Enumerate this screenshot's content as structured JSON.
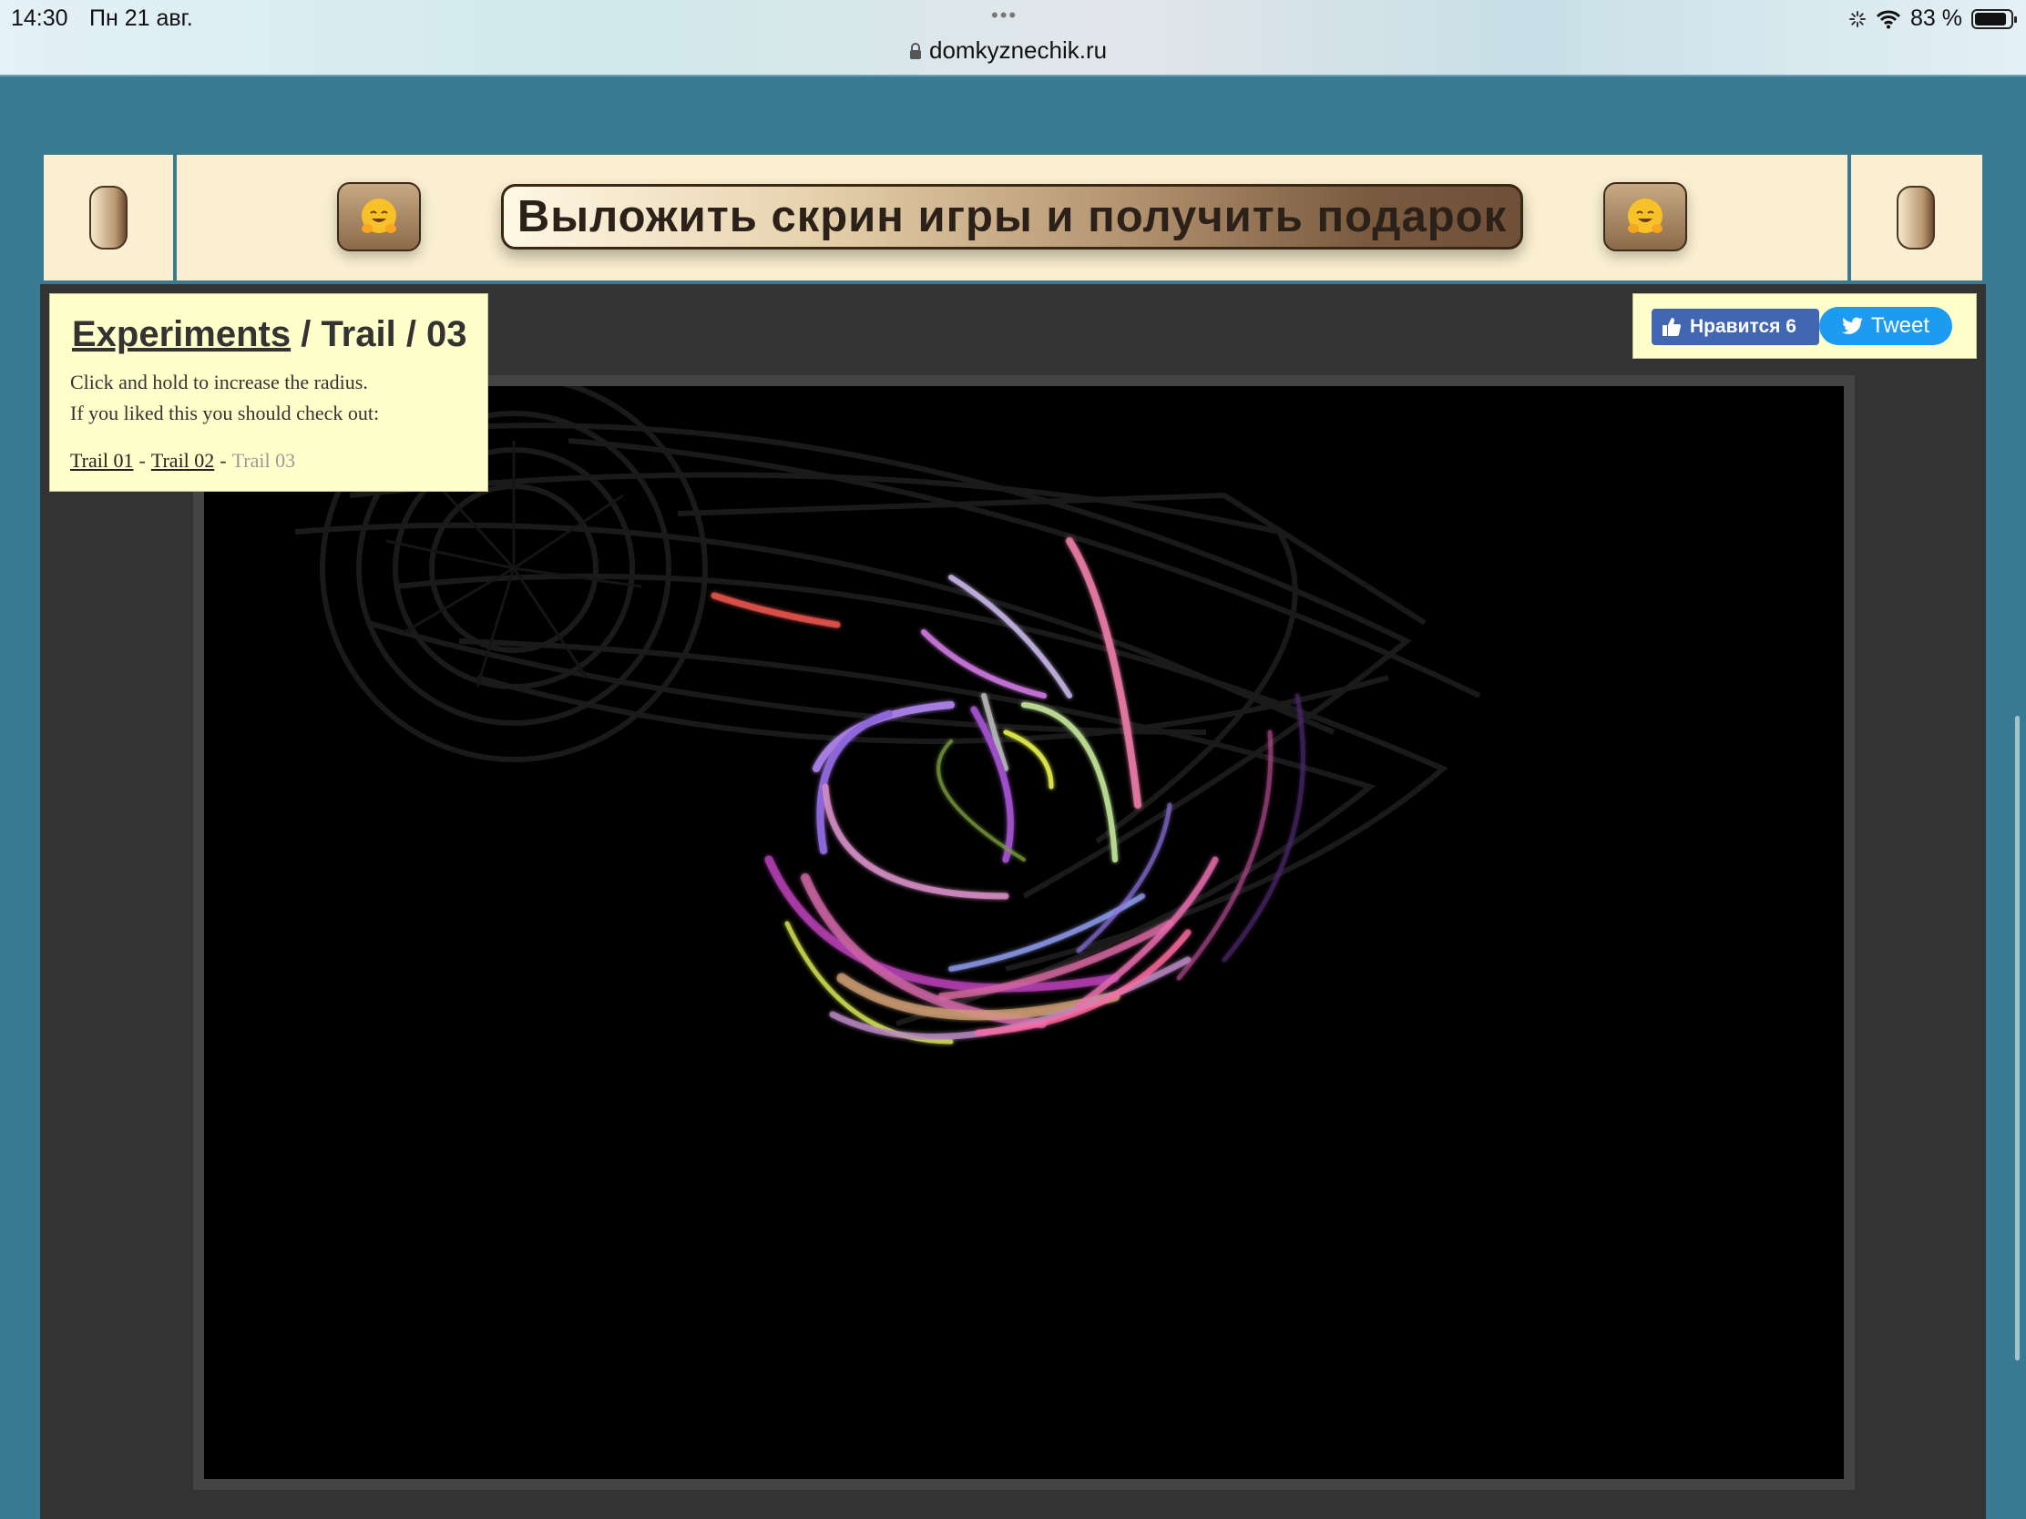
{
  "status_bar": {
    "time": "14:30",
    "date": "Пн 21 авг.",
    "dots": "•••",
    "url": "domkyznechik.ru",
    "battery": "83 %",
    "icons": [
      "loading-icon",
      "wifi-icon",
      "battery-icon",
      "lock-icon"
    ]
  },
  "banner": {
    "cta": "Выложить скрин игры и получить подарок",
    "icons": [
      "hugging-face-icon",
      "hugging-face-icon"
    ]
  },
  "info": {
    "title_link": "Experiments",
    "title_rest": " / Trail / 03",
    "line1": "Click and hold to increase the radius.",
    "line2": "If you liked this you should check out:",
    "links": [
      {
        "label": "Trail 01"
      },
      {
        "label": "Trail 02"
      },
      {
        "label": "Trail 03"
      }
    ],
    "separator": "-"
  },
  "social": {
    "like_label": "Нравится 6",
    "tweet_label": "Tweet"
  },
  "colors": {
    "page_bg": "#387b92",
    "banner_bg": "#faefd0",
    "info_bg": "#ffffcc",
    "canvas_bg": "#000000",
    "facebook": "#4267b2",
    "twitter": "#1d9bf0"
  }
}
